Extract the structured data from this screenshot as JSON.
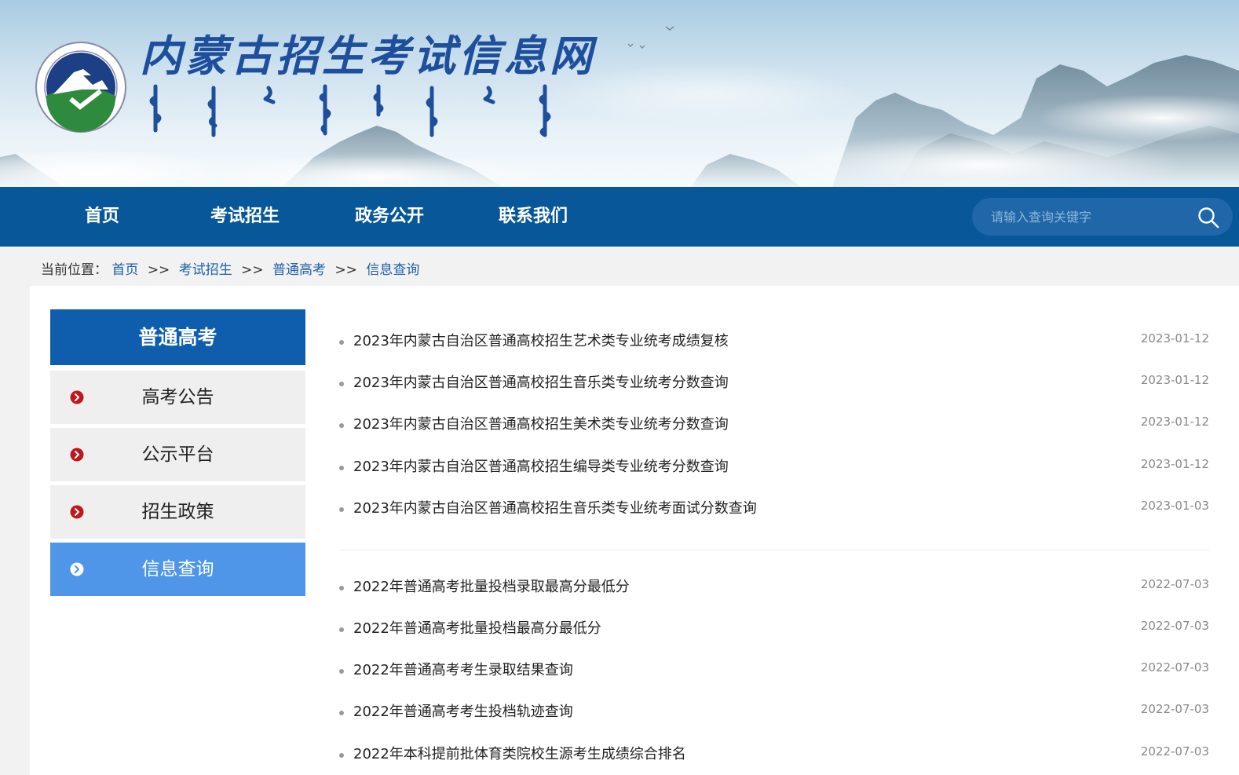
{
  "header": {
    "site_title": "内蒙古招生考试信息网"
  },
  "nav": {
    "items": [
      {
        "label": "首页"
      },
      {
        "label": "考试招生"
      },
      {
        "label": "政务公开"
      },
      {
        "label": "联系我们"
      }
    ],
    "search_placeholder": "请输入查询关键字"
  },
  "breadcrumb": {
    "prefix": "当前位置：",
    "items": [
      "首页",
      "考试招生",
      "普通高考",
      "信息查询"
    ],
    "separator": ">>"
  },
  "sidebar": {
    "title": "普通高考",
    "items": [
      {
        "label": "高考公告",
        "active": false
      },
      {
        "label": "公示平台",
        "active": false
      },
      {
        "label": "招生政策",
        "active": false
      },
      {
        "label": "信息查询",
        "active": true
      }
    ]
  },
  "news": {
    "group_1": [
      {
        "title": "2023年内蒙古自治区普通高校招生艺术类专业统考成绩复核",
        "date": "2023-01-12"
      },
      {
        "title": "2023年内蒙古自治区普通高校招生音乐类专业统考分数查询",
        "date": "2023-01-12"
      },
      {
        "title": "2023年内蒙古自治区普通高校招生美术类专业统考分数查询",
        "date": "2023-01-12"
      },
      {
        "title": "2023年内蒙古自治区普通高校招生编导类专业统考分数查询",
        "date": "2023-01-12"
      },
      {
        "title": "2023年内蒙古自治区普通高校招生音乐类专业统考面试分数查询",
        "date": "2023-01-03"
      }
    ],
    "group_2": [
      {
        "title": "2022年普通高考批量投档录取最高分最低分",
        "date": "2022-07-03"
      },
      {
        "title": "2022年普通高考批量投档最高分最低分",
        "date": "2022-07-03"
      },
      {
        "title": "2022年普通高考考生录取结果查询",
        "date": "2022-07-03"
      },
      {
        "title": "2022年普通高考考生投档轨迹查询",
        "date": "2022-07-03"
      },
      {
        "title": "2022年本科提前批体育类院校生源考生成绩综合排名",
        "date": "2022-07-03"
      }
    ]
  },
  "colors": {
    "nav_bg": "#085799",
    "sidebar_header_bg": "#0f5eae",
    "sidebar_active_bg": "#4f95e8",
    "bullet_red": "#c0171d",
    "link_blue": "#1f5fa8"
  },
  "icons": {
    "search": "search-icon",
    "bullet": "chevron-right-circle-icon",
    "logo": "emblem-logo"
  }
}
